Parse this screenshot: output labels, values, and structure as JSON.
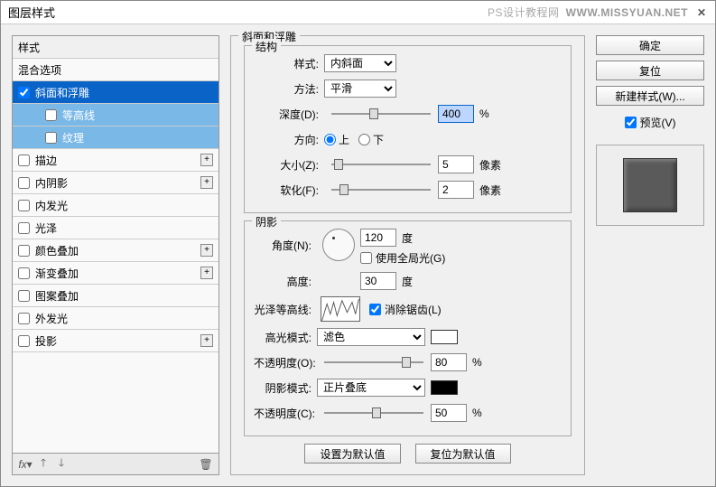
{
  "window": {
    "title": "图层样式",
    "watermark_left": "PS设计教程网",
    "watermark_right": "WWW.MISSYUAN.NET"
  },
  "styles_header": "样式",
  "blend_header": "混合选项",
  "rows": {
    "bevel": "斜面和浮雕",
    "contour": "等高线",
    "texture": "纹理",
    "stroke": "描边",
    "inner_shadow": "内阴影",
    "inner_glow": "内发光",
    "satin": "光泽",
    "color_overlay": "颜色叠加",
    "gradient_overlay": "渐变叠加",
    "pattern_overlay": "图案叠加",
    "outer_glow": "外发光",
    "drop_shadow": "投影"
  },
  "panel": {
    "title": "斜面和浮雕",
    "group_structure": "结构",
    "group_shading": "阴影",
    "style_label": "样式:",
    "style_value": "内斜面",
    "technique_label": "方法:",
    "technique_value": "平滑",
    "depth_label": "深度(D):",
    "depth_value": "400",
    "percent": "%",
    "direction_label": "方向:",
    "dir_up": "上",
    "dir_down": "下",
    "size_label": "大小(Z):",
    "size_value": "5",
    "pixels": "像素",
    "soften_label": "软化(F):",
    "soften_value": "2",
    "angle_label": "角度(N):",
    "angle_value": "120",
    "degree": "度",
    "use_global": "使用全局光(G)",
    "altitude_label": "高度:",
    "altitude_value": "30",
    "gloss_contour_label": "光泽等高线:",
    "antialias": "消除锯齿(L)",
    "highlight_mode_label": "高光模式:",
    "highlight_mode_value": "滤色",
    "opacity_label_h": "不透明度(O):",
    "opacity_value_h": "80",
    "shadow_mode_label": "阴影模式:",
    "shadow_mode_value": "正片叠底",
    "opacity_label_s": "不透明度(C):",
    "opacity_value_s": "50",
    "defaults_set": "设置为默认值",
    "defaults_reset": "复位为默认值"
  },
  "buttons": {
    "ok": "确定",
    "cancel": "复位",
    "new_style": "新建样式(W)...",
    "preview": "预览(V)"
  },
  "colors": {
    "highlight": "#ffffff",
    "shadow": "#000000"
  }
}
